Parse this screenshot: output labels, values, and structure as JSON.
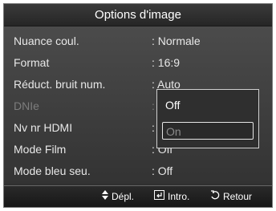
{
  "menu": {
    "title": "Options d'image",
    "rows": [
      {
        "label": "Nuance coul.",
        "value": ": Normale"
      },
      {
        "label": "Format",
        "value": ": 16:9"
      },
      {
        "label": "Réduct. bruit num.",
        "value": ": Auto"
      },
      {
        "label": "DNIe",
        "value": ": "
      },
      {
        "label": "Nv nr HDMI",
        "value": ": "
      },
      {
        "label": "Mode Film",
        "value": ": Off"
      },
      {
        "label": "Mode bleu seu.",
        "value": ": Off"
      }
    ]
  },
  "popup": {
    "options": [
      "Off",
      "On"
    ],
    "selected": "On"
  },
  "footer": {
    "move_label": "Dépl.",
    "enter_label": "Intro.",
    "return_label": "Retour",
    "icons": [
      "updown-arrow-icon",
      "enter-icon",
      "return-icon"
    ]
  }
}
